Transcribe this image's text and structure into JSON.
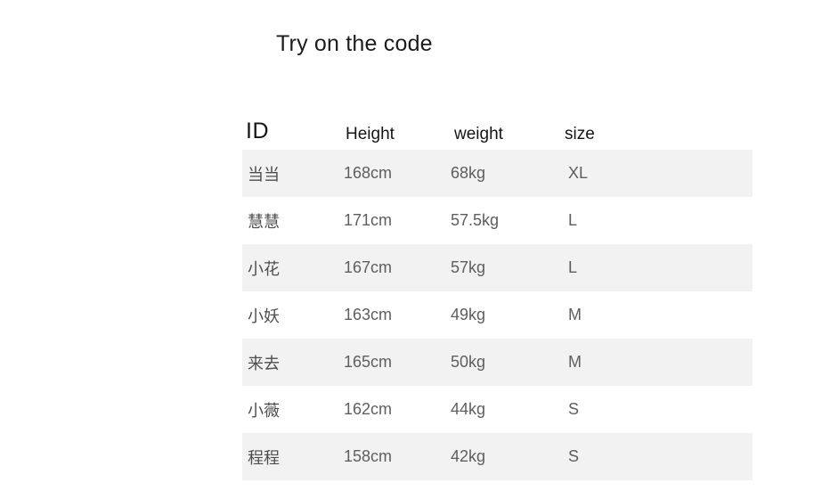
{
  "title": "Try on the code",
  "table": {
    "columns": [
      {
        "key": "id",
        "label": "ID"
      },
      {
        "key": "height",
        "label": "Height"
      },
      {
        "key": "weight",
        "label": "weight"
      },
      {
        "key": "size",
        "label": "size"
      }
    ],
    "rows": [
      {
        "id": "当当",
        "height": "168cm",
        "weight": "68kg",
        "size": "XL"
      },
      {
        "id": "慧慧",
        "height": "171cm",
        "weight": "57.5kg",
        "size": "L"
      },
      {
        "id": "小花",
        "height": "167cm",
        "weight": "57kg",
        "size": "L"
      },
      {
        "id": "小妖",
        "height": "163cm",
        "weight": "49kg",
        "size": "M"
      },
      {
        "id": "来去",
        "height": "165cm",
        "weight": "50kg",
        "size": "M"
      },
      {
        "id": "小薇",
        "height": "162cm",
        "weight": "44kg",
        "size": "S"
      },
      {
        "id": "程程",
        "height": "158cm",
        "weight": "42kg",
        "size": "S"
      }
    ]
  },
  "colors": {
    "page_background": "#ffffff",
    "row_shaded": "#f2f2f2",
    "row_plain": "#ffffff",
    "header_text": "#151515",
    "body_text": "#5e5e5e",
    "title_text": "#1c1c1c"
  }
}
